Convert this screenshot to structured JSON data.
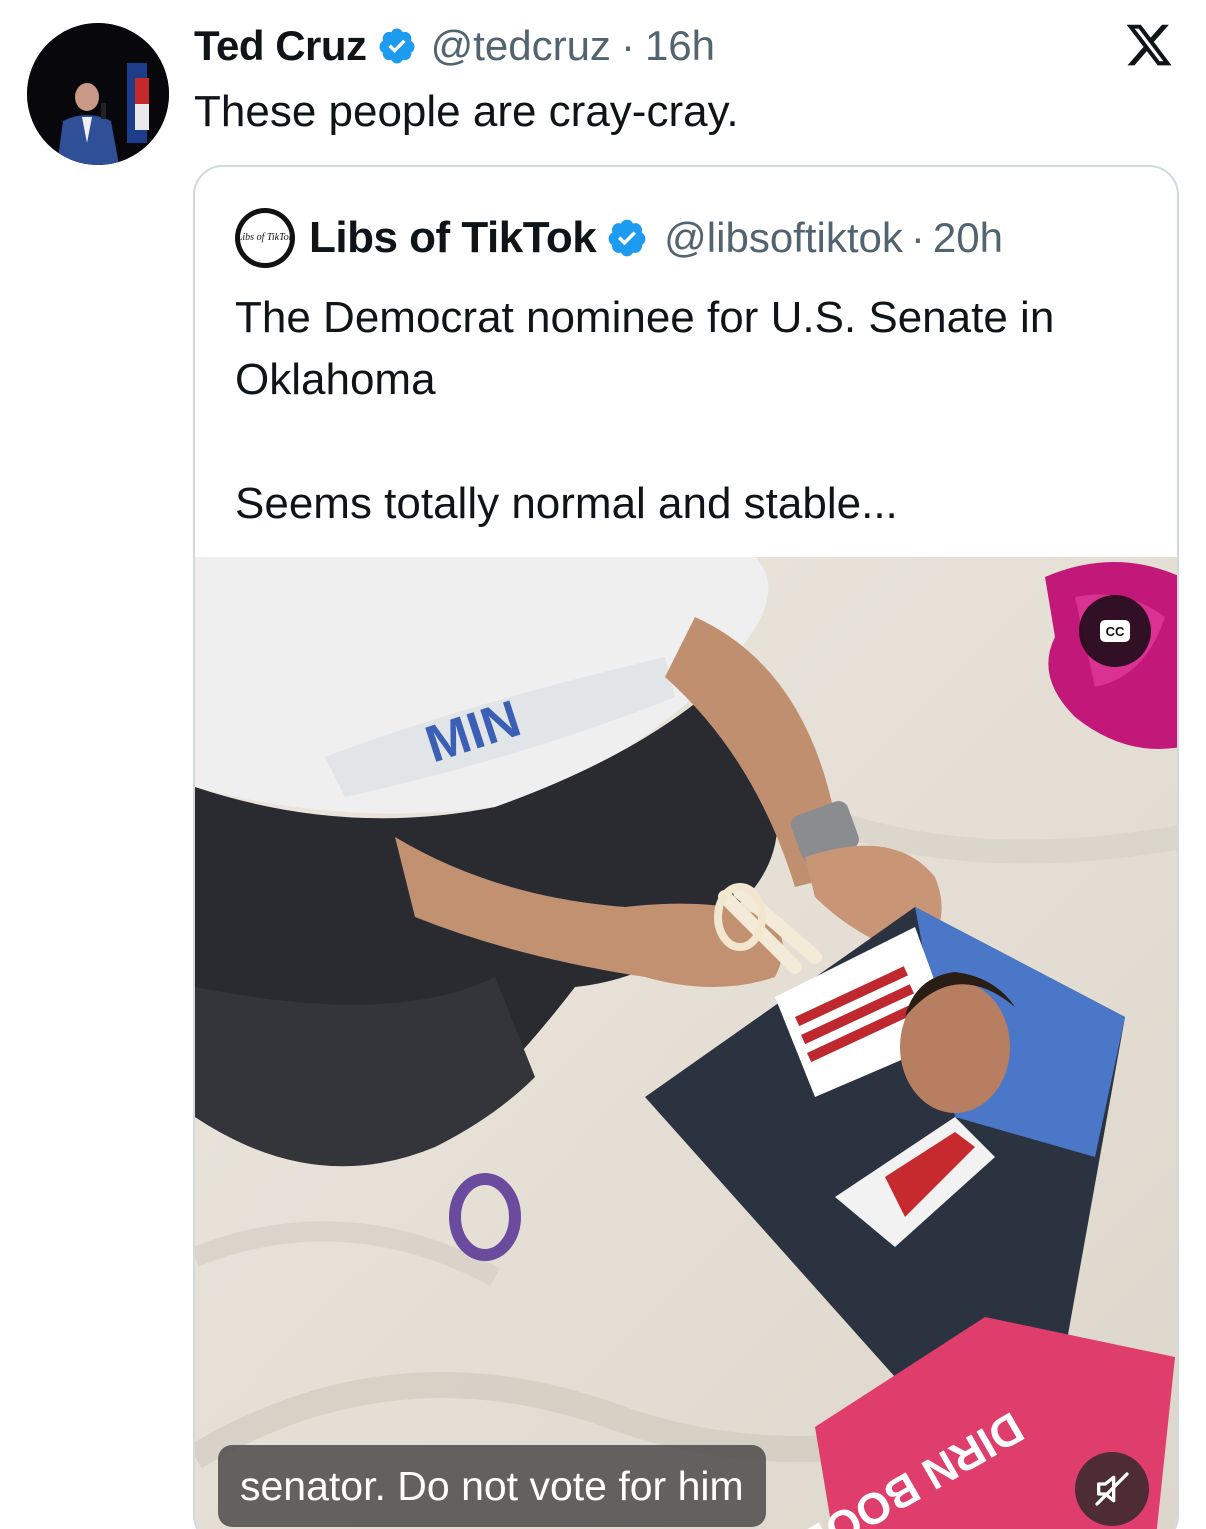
{
  "tweet": {
    "author_name": "Ted Cruz",
    "author_handle": "@tedcruz",
    "separator": "·",
    "timestamp": "16h",
    "text": "These people are cray-cray.",
    "verified_icon": "verified-badge-icon",
    "platform_icon": "x-logo-icon"
  },
  "quote": {
    "author_name": "Libs of TikTok",
    "author_handle": "@libsoftiktok",
    "separator": "·",
    "timestamp": "20h",
    "text_line1": "The Democrat nominee for U.S. Senate in Oklahoma",
    "text_line2": "Seems totally normal and stable...",
    "avatar_text": "Libs of TikTok",
    "verified_icon": "verified-badge-icon"
  },
  "video": {
    "caption": "senator. Do not vote for him",
    "cc_label": "CC",
    "mute_icon": "muted-speaker-icon",
    "shirt_text": "MIN",
    "sign_text": "DIRN BOOB"
  },
  "colors": {
    "verified_blue": "#1d9bf0",
    "secondary_text": "#536471",
    "border": "#cfd9de"
  }
}
